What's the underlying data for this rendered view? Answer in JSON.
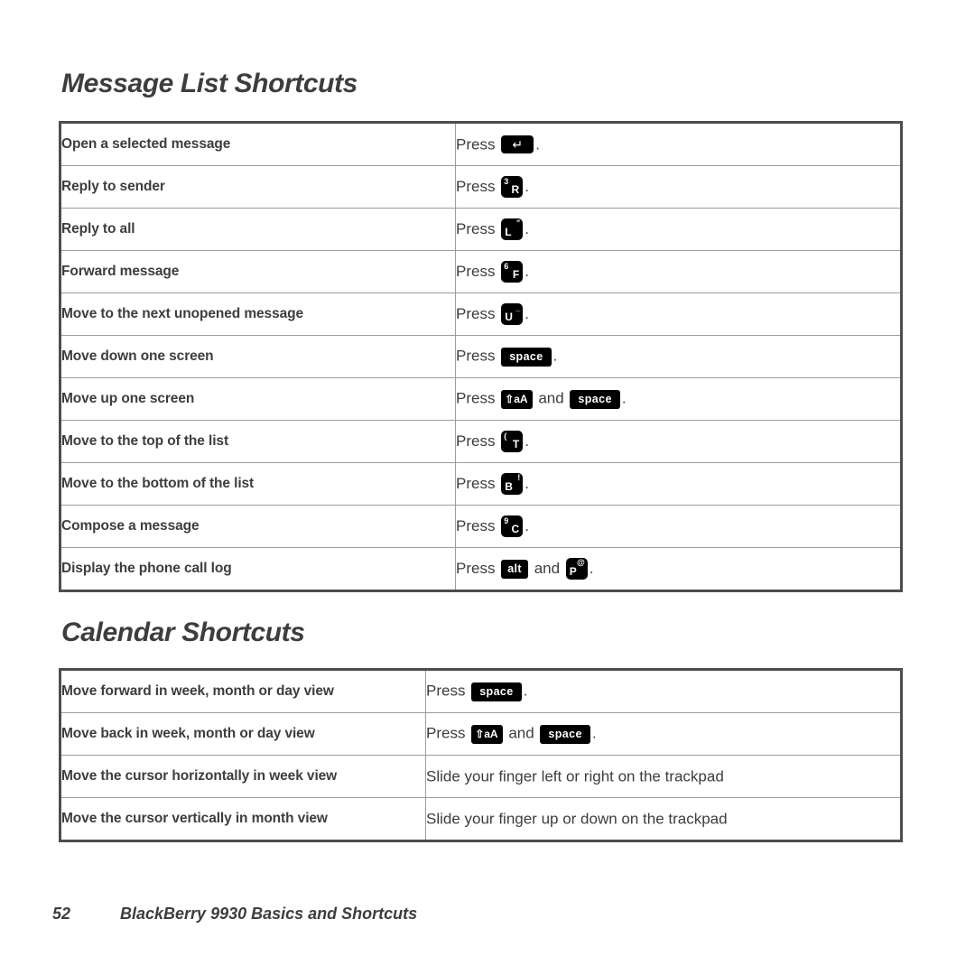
{
  "sections": [
    {
      "heading": "Message List Shortcuts",
      "rows": [
        {
          "action": "Open a selected message",
          "prefix": "Press",
          "keys": [
            {
              "type": "enter",
              "glyph": "↵",
              "name": "enter-key"
            }
          ],
          "suffix": "."
        },
        {
          "action": "Reply to sender",
          "prefix": "Press",
          "keys": [
            {
              "type": "letter",
              "layout": "sup-left",
              "sup": "3",
              "main": "R",
              "name": "r-key"
            }
          ],
          "suffix": "."
        },
        {
          "action": "Reply to all",
          "prefix": "Press",
          "keys": [
            {
              "type": "letter",
              "layout": "sup-right",
              "sup": "”",
              "main": "L",
              "name": "l-key"
            }
          ],
          "suffix": "."
        },
        {
          "action": "Forward message",
          "prefix": "Press",
          "keys": [
            {
              "type": "letter",
              "layout": "sup-left",
              "sup": "6",
              "main": "F",
              "name": "f-key"
            }
          ],
          "suffix": "."
        },
        {
          "action": "Move to the next unopened message",
          "prefix": "Press",
          "keys": [
            {
              "type": "letter",
              "layout": "sup-right",
              "sup": "_",
              "main": "U",
              "name": "u-key"
            }
          ],
          "suffix": "."
        },
        {
          "action": "Move down one screen",
          "prefix": "Press",
          "keys": [
            {
              "type": "word",
              "label": "space",
              "name": "space-key"
            }
          ],
          "suffix": "."
        },
        {
          "action": "Move up one screen",
          "prefix": "Press",
          "keys": [
            {
              "type": "shift",
              "arrow": "⇧",
              "label": "aA",
              "name": "shift-key"
            },
            {
              "type": "conjunction",
              "label": "and"
            },
            {
              "type": "word",
              "label": "space",
              "name": "space-key"
            }
          ],
          "suffix": "."
        },
        {
          "action": "Move to the top of the list",
          "prefix": "Press",
          "keys": [
            {
              "type": "letter",
              "layout": "sup-left",
              "sup": "(",
              "main": "T",
              "name": "t-key"
            }
          ],
          "suffix": "."
        },
        {
          "action": "Move to the bottom of the list",
          "prefix": "Press",
          "keys": [
            {
              "type": "letter",
              "layout": "sup-right",
              "sup": "!",
              "main": "B",
              "name": "b-key"
            }
          ],
          "suffix": "."
        },
        {
          "action": "Compose a message",
          "prefix": "Press",
          "keys": [
            {
              "type": "letter",
              "layout": "sup-left",
              "sup": "9",
              "main": "C",
              "name": "c-key"
            }
          ],
          "suffix": "."
        },
        {
          "action": "Display the phone call log",
          "prefix": "Press",
          "keys": [
            {
              "type": "word",
              "label": "alt",
              "name": "alt-key"
            },
            {
              "type": "conjunction",
              "label": "and"
            },
            {
              "type": "letter",
              "layout": "sup-right",
              "sup": "@",
              "main": "P",
              "name": "p-key"
            }
          ],
          "suffix": "."
        }
      ]
    },
    {
      "heading": "Calendar Shortcuts",
      "rows": [
        {
          "action": "Move forward in week, month or day view",
          "prefix": "Press",
          "keys": [
            {
              "type": "word",
              "label": "space",
              "name": "space-key"
            }
          ],
          "suffix": "."
        },
        {
          "action": "Move back in week, month or day view",
          "prefix": "Press",
          "keys": [
            {
              "type": "shift",
              "arrow": "⇧",
              "label": "aA",
              "name": "shift-key"
            },
            {
              "type": "conjunction",
              "label": "and"
            },
            {
              "type": "word",
              "label": "space",
              "name": "space-key"
            }
          ],
          "suffix": "."
        },
        {
          "action": "Move the cursor horizontally in week view",
          "prefix": "Slide your finger left or right on the trackpad",
          "keys": [],
          "suffix": ""
        },
        {
          "action": "Move the cursor vertically in month view",
          "prefix": "Slide your finger up or down on the trackpad",
          "keys": [],
          "suffix": ""
        }
      ]
    }
  ],
  "footer": {
    "page_number": "52",
    "doc_title": "BlackBerry 9930 Basics and Shortcuts"
  },
  "colors": {
    "text": "#3d3d3d",
    "key_background": "#000000",
    "key_foreground": "#ffffff",
    "table_outer_border": "#4d4d4d",
    "table_inner_border": "#9c9c9c",
    "page_background": "#ffffff"
  }
}
